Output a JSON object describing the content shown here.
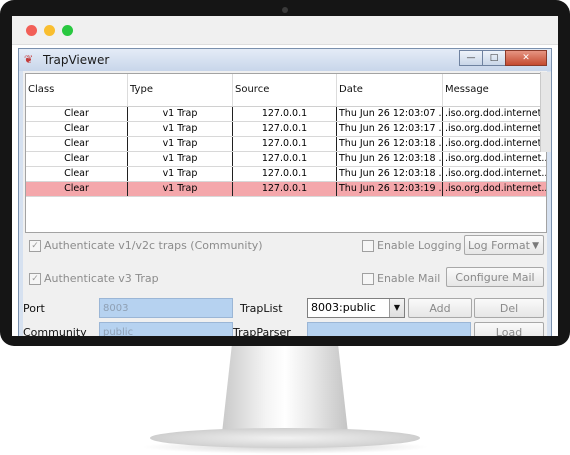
{
  "window": {
    "title": "TrapViewer",
    "controls": {
      "minimize": "—",
      "maximize": "□",
      "close": "✕"
    }
  },
  "table": {
    "columns": [
      "Class",
      "Type",
      "Source",
      "Date",
      "Message"
    ],
    "rows": [
      [
        "Clear",
        "v1 Trap",
        "127.0.0.1",
        "Thu Jun 26 12:03:07 ...",
        ".iso.org.dod.internet..."
      ],
      [
        "Clear",
        "v1 Trap",
        "127.0.0.1",
        "Thu Jun 26 12:03:17 ...",
        ".iso.org.dod.internet..."
      ],
      [
        "Clear",
        "v1 Trap",
        "127.0.0.1",
        "Thu Jun 26 12:03:18 ...",
        ".iso.org.dod.internet..."
      ],
      [
        "Clear",
        "v1 Trap",
        "127.0.0.1",
        "Thu Jun 26 12:03:18 ...",
        ".iso.org.dod.internet..."
      ],
      [
        "Clear",
        "v1 Trap",
        "127.0.0.1",
        "Thu Jun 26 12:03:18 ...",
        ".iso.org.dod.internet..."
      ],
      [
        "Clear",
        "v1 Trap",
        "127.0.0.1",
        "Thu Jun 26 12:03:19 ...",
        ".iso.org.dod.internet..."
      ]
    ],
    "highlighted_row": 5,
    "highlight_color": "#f4a7ab"
  },
  "options": {
    "auth_v1v2c": "Authenticate v1/v2c traps (Community)",
    "auth_v3": "Authenticate v3 Trap",
    "enable_logging": "Enable Logging",
    "log_format": "Log Format",
    "enable_mail": "Enable Mail",
    "configure_mail": "Configure Mail"
  },
  "form": {
    "port_label": "Port",
    "port_value": "8003",
    "community_label": "Community",
    "community_value": "public",
    "traplist_label": "TrapList",
    "traplist_value": "8003:public",
    "trapparser_label": "TrapParser",
    "add_label": "Add",
    "del_label": "Del",
    "load_label": "Load"
  },
  "colors": {
    "field_bg": "#b6d2f0",
    "window_frame": "#d6e1f0",
    "monitor_bezel": "#151515"
  }
}
